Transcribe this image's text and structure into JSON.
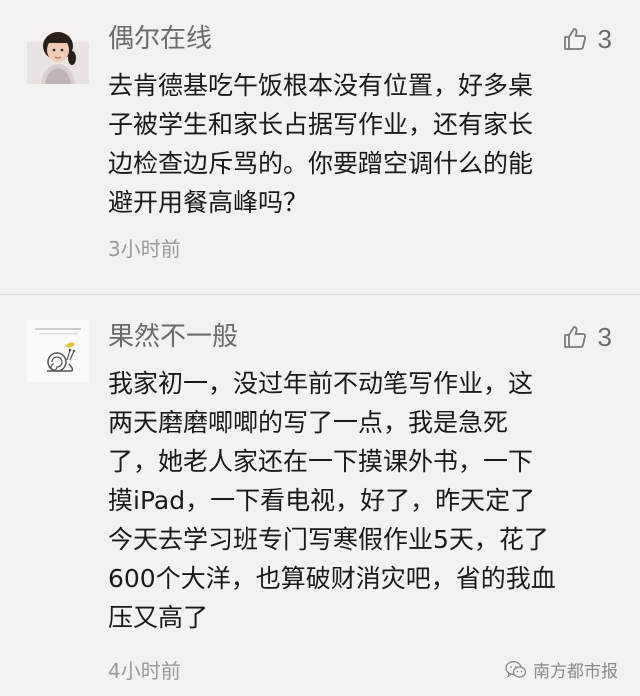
{
  "comments": [
    {
      "username": "偶尔在线",
      "likes": "3",
      "avatar": "girl-photo-avatar",
      "lines": [
        "去肯德基吃午饭根本没有位置，好多桌",
        "子被学生和家长占据写作业，还有家长",
        "边检查边斥骂的。你要蹭空调什么的能",
        "避开用餐高峰吗？"
      ],
      "time": "3小时前"
    },
    {
      "username": "果然不一般",
      "likes": "3",
      "avatar": "snail-drawing-avatar",
      "lines": [
        "我家初一，没过年前不动笔写作业，这",
        "两天磨磨唧唧的写了一点，我是急死",
        "了，她老人家还在一下摸课外书，一下",
        "摸iPad，一下看电视，好了，昨天定了",
        "今天去学习班专门写寒假作业5天，花了",
        "600个大洋，也算破财消灾吧，省的我血",
        "压又高了"
      ],
      "time": "4小时前"
    }
  ],
  "watermark": {
    "text": "南方都市报",
    "icon": "wechat-icon"
  },
  "colors": {
    "background": "#f2f2f2",
    "username": "#6b6b6b",
    "body_text": "#1a1a1a",
    "timestamp": "#9a9a9a"
  }
}
